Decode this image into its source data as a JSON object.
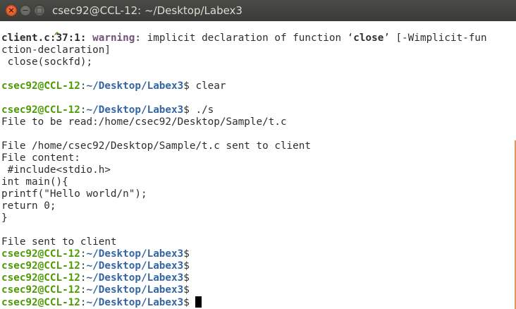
{
  "window": {
    "title": "csec92@CCL-12: ~/Desktop/Labex3",
    "close_glyph": "×",
    "minimize_glyph": "−",
    "maximize_glyph": "□"
  },
  "terminal": {
    "caret": "^",
    "warning_location": "client.c:37:1:",
    "warning_label": "warning:",
    "warning_text_1": "implicit declaration of function ",
    "quote_open": "‘",
    "function_name": "close",
    "quote_close": "’",
    "warning_text_2": " [-Wimplicit-fun",
    "warning_text_3": "ction-declaration]",
    "code_line": " close(sockfd);",
    "prompt_user": "csec92@CCL-12",
    "prompt_colon": ":",
    "prompt_path": "~/Desktop/Labex3",
    "prompt_symbol": "$",
    "cmd_clear": " clear",
    "cmd_run": " ./s",
    "file_to_read": "File to be read:/home/csec92/Desktop/Sample/t.c",
    "file_sent_line": "File /home/csec92/Desktop/Sample/t.c sent to client",
    "file_content_label": "File content:",
    "content_lines": [
      " #include<stdio.h>",
      "int main(){",
      "printf(\"Hello world/n\");",
      "return 0;",
      "}"
    ],
    "file_sent_client": "File sent to client"
  }
}
